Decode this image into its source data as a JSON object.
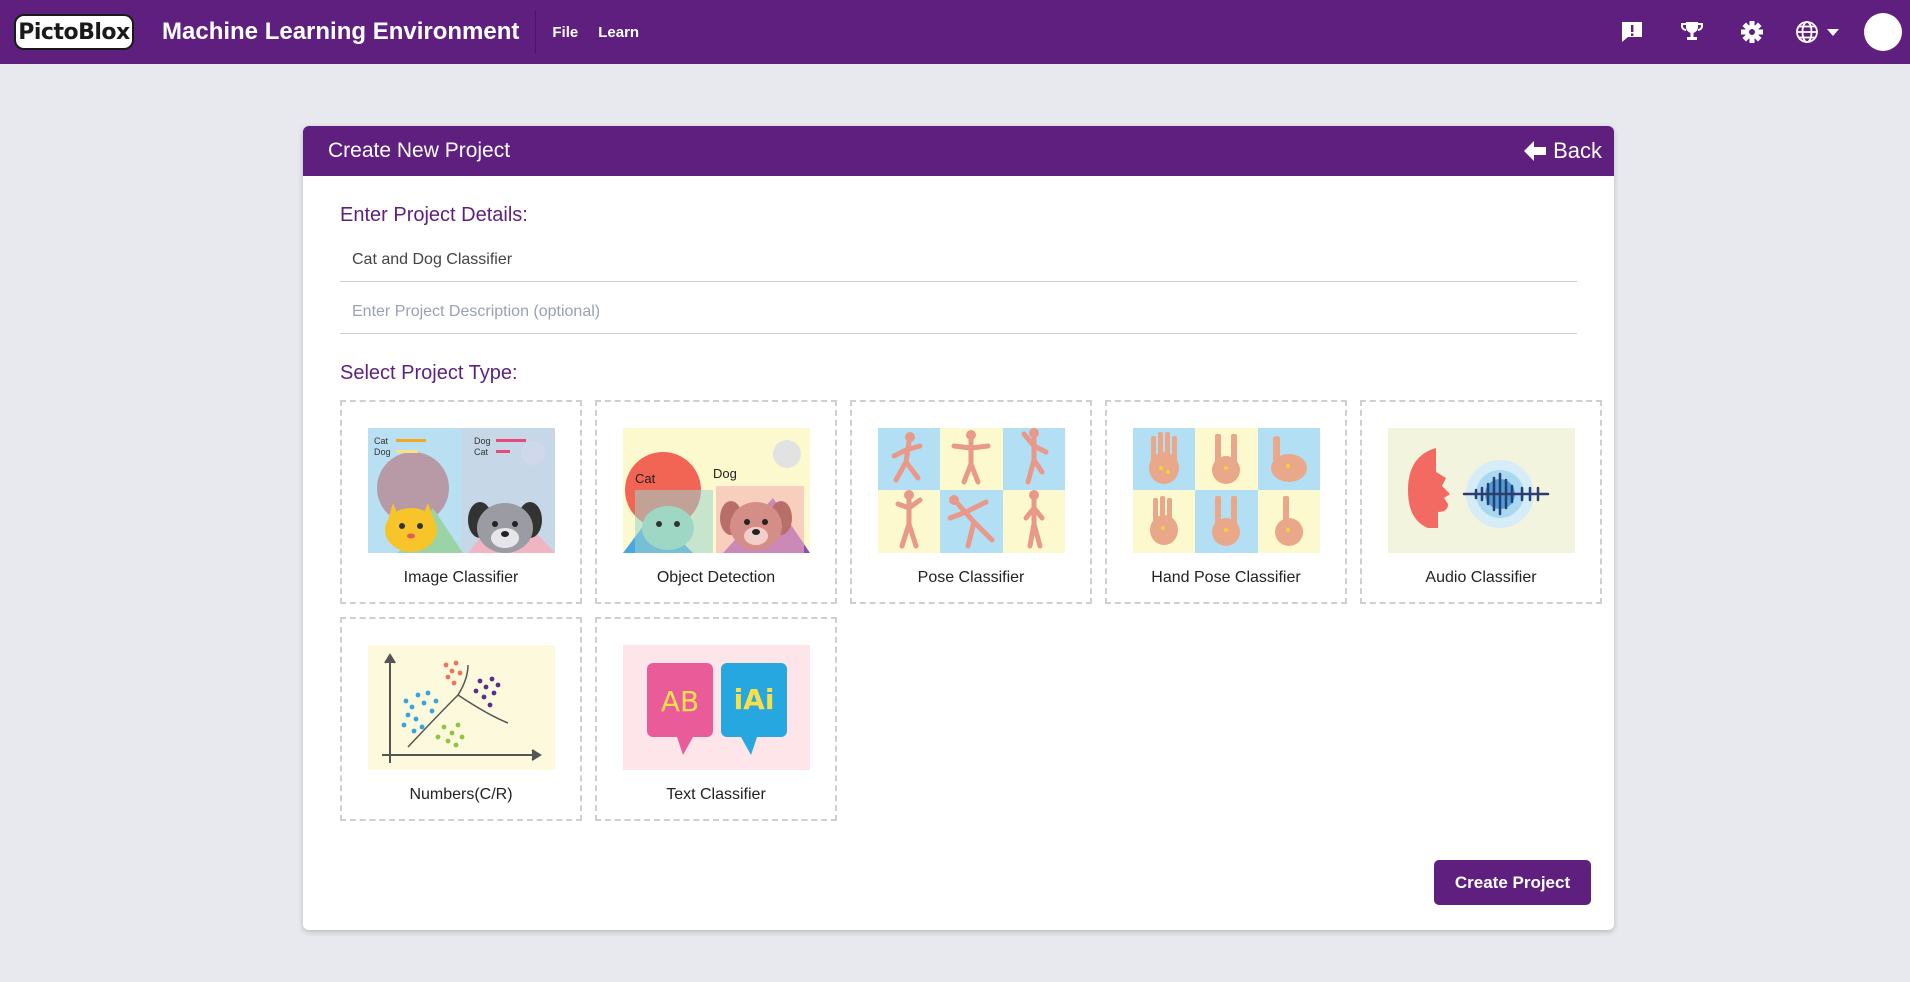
{
  "app": {
    "logo_text": "PictoBlox",
    "title": "Machine Learning Environment",
    "menu": [
      {
        "label": "File"
      },
      {
        "label": "Learn"
      }
    ]
  },
  "card": {
    "title": "Create New Project",
    "back_label": "Back",
    "details_label": "Enter Project Details:",
    "project_name_value": "Cat and Dog Classifier",
    "project_description_placeholder": "Enter Project Description (optional)",
    "type_label": "Select Project Type:",
    "project_types": [
      {
        "label": "Image Classifier",
        "icon": "image-classifier"
      },
      {
        "label": "Object Detection",
        "icon": "object-detection"
      },
      {
        "label": "Pose Classifier",
        "icon": "pose-classifier"
      },
      {
        "label": "Hand Pose Classifier",
        "icon": "hand-pose-classifier"
      },
      {
        "label": "Audio Classifier",
        "icon": "audio-classifier"
      },
      {
        "label": "Numbers(C/R)",
        "icon": "numbers-classifier"
      },
      {
        "label": "Text Classifier",
        "icon": "text-classifier"
      }
    ],
    "create_button_label": "Create Project"
  },
  "image_text": {
    "image_classifier": [
      "Cat",
      "Dog",
      "Dog",
      "Cat"
    ],
    "object_detection": [
      "Cat",
      "Dog"
    ],
    "text_classifier": [
      "AB",
      "iAi"
    ]
  },
  "colors": {
    "brand_purple": "#5e1f7e",
    "page_background": "#e8e9ee"
  },
  "header_icons": [
    "feedback-icon",
    "trophy-icon",
    "settings-gear-icon",
    "language-globe-icon",
    "user-avatar"
  ]
}
